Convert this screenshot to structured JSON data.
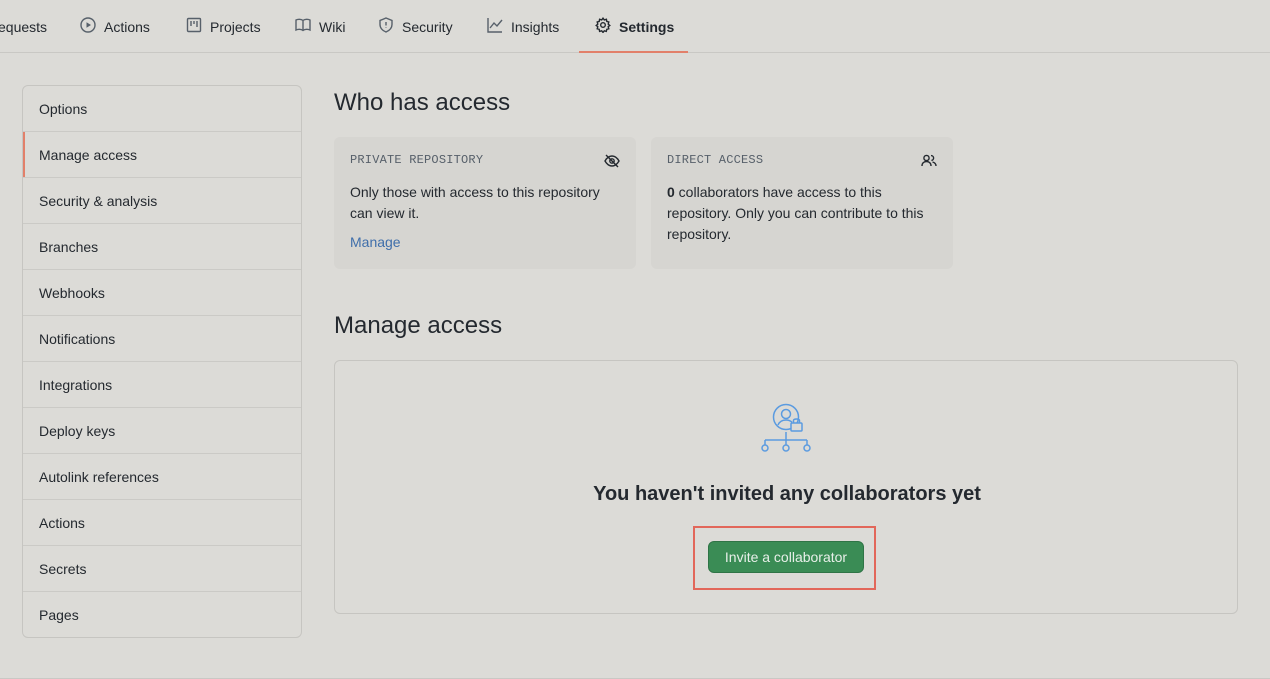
{
  "tabs": [
    {
      "label": "equests",
      "icon": "pull-request-icon"
    },
    {
      "label": "Actions",
      "icon": "play-icon"
    },
    {
      "label": "Projects",
      "icon": "project-icon"
    },
    {
      "label": "Wiki",
      "icon": "book-icon"
    },
    {
      "label": "Security",
      "icon": "shield-icon"
    },
    {
      "label": "Insights",
      "icon": "graph-icon"
    },
    {
      "label": "Settings",
      "icon": "gear-icon",
      "active": true
    }
  ],
  "sidebar": {
    "items": [
      {
        "label": "Options"
      },
      {
        "label": "Manage access",
        "selected": true
      },
      {
        "label": "Security & analysis"
      },
      {
        "label": "Branches"
      },
      {
        "label": "Webhooks"
      },
      {
        "label": "Notifications"
      },
      {
        "label": "Integrations"
      },
      {
        "label": "Deploy keys"
      },
      {
        "label": "Autolink references"
      },
      {
        "label": "Actions"
      },
      {
        "label": "Secrets"
      },
      {
        "label": "Pages"
      }
    ]
  },
  "who_has_access": {
    "title": "Who has access",
    "private_card": {
      "label": "PRIVATE REPOSITORY",
      "icon": "eye-closed-icon",
      "text": "Only those with access to this repository can view it.",
      "link": "Manage"
    },
    "direct_card": {
      "label": "DIRECT ACCESS",
      "icon": "people-icon",
      "count": "0",
      "text": " collaborators have access to this repository. Only you can contribute to this repository."
    }
  },
  "manage_access": {
    "title": "Manage access",
    "empty_title": "You haven't invited any collaborators yet",
    "invite_button": "Invite a collaborator"
  },
  "colors": {
    "accent_underline": "#e2806a",
    "link": "#3f6eaa",
    "primary_button": "#3a8c55",
    "highlight_border": "#e2675a",
    "illustration": "#5b9be0"
  }
}
